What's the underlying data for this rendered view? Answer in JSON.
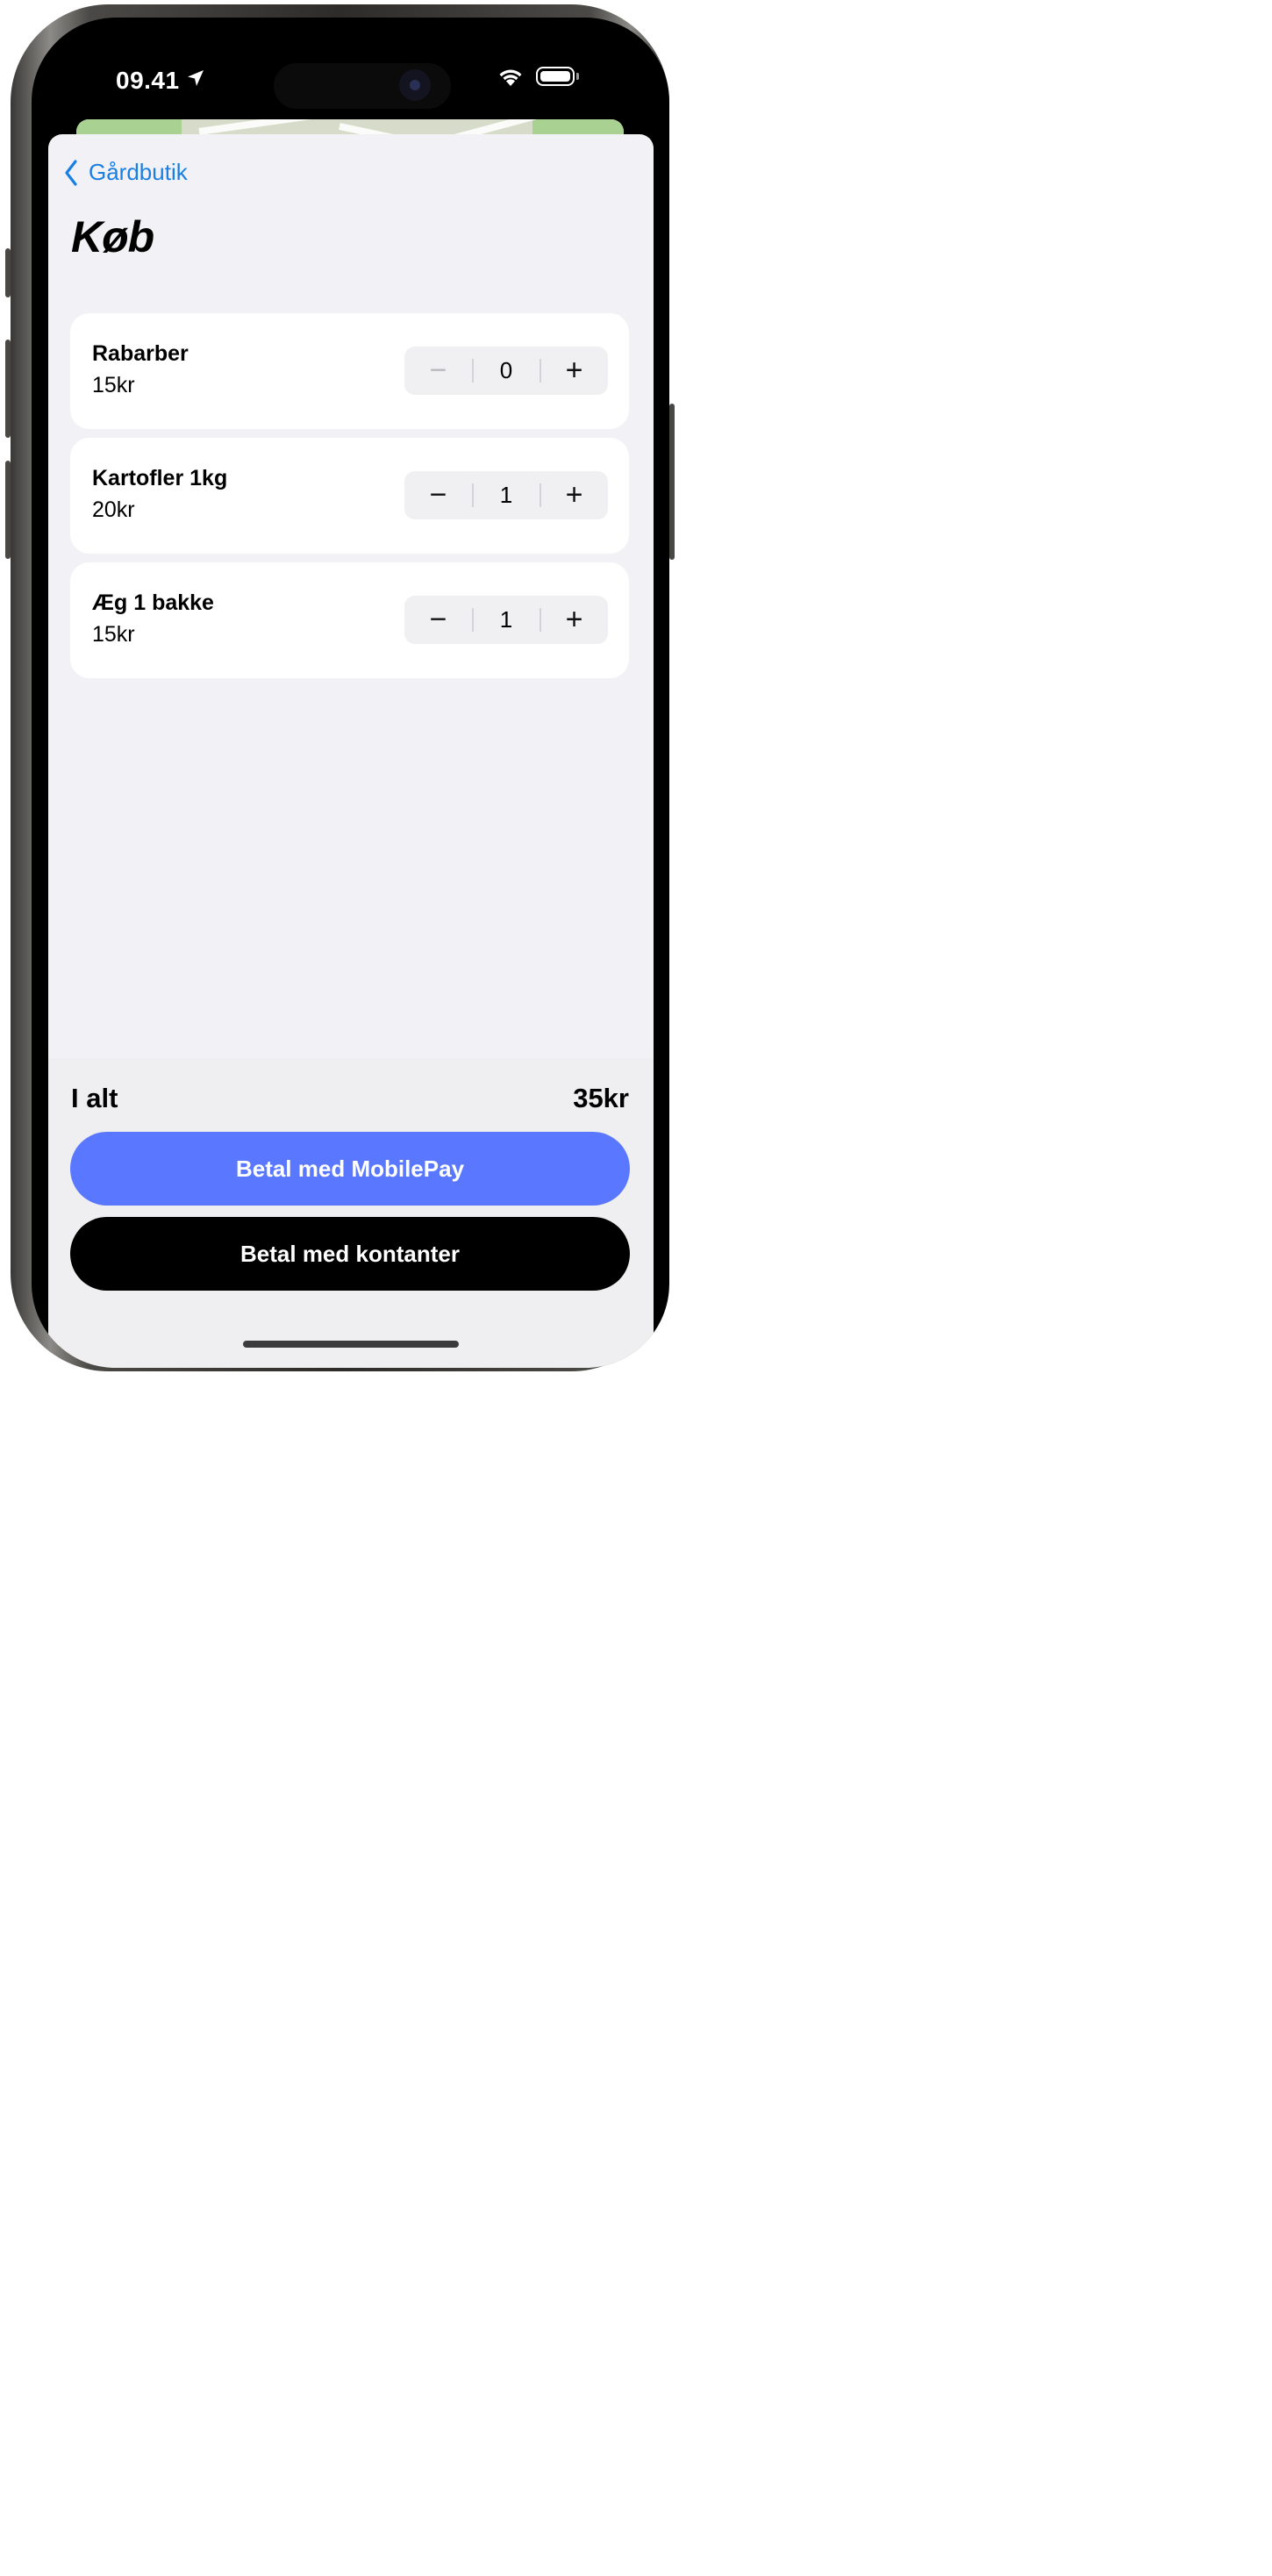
{
  "status_bar": {
    "time": "09.41"
  },
  "nav": {
    "back_label": "Gårdbutik"
  },
  "page": {
    "title": "Køb"
  },
  "items": [
    {
      "name": "Rabarber",
      "price": "15kr",
      "quantity": "0",
      "minus_disabled": true
    },
    {
      "name": "Kartofler 1kg",
      "price": "20kr",
      "quantity": "1",
      "minus_disabled": false
    },
    {
      "name": "Æg 1 bakke",
      "price": "15kr",
      "quantity": "1",
      "minus_disabled": false
    }
  ],
  "stepper": {
    "minus_symbol": "−",
    "plus_symbol": "+"
  },
  "summary": {
    "total_label": "I alt",
    "total_value": "35kr"
  },
  "buttons": {
    "mobilepay_label": "Betal med MobilePay",
    "cash_label": "Betal med kontanter"
  },
  "colors": {
    "accent_blue": "#1a7fe2",
    "mobilepay_blue": "#5a78ff",
    "sheet_bg": "#f2f2f6",
    "cash_button": "#000000"
  },
  "icons": {
    "back": "chevron-left-icon",
    "location": "location-arrow-icon",
    "wifi": "wifi-icon",
    "battery": "battery-icon"
  }
}
